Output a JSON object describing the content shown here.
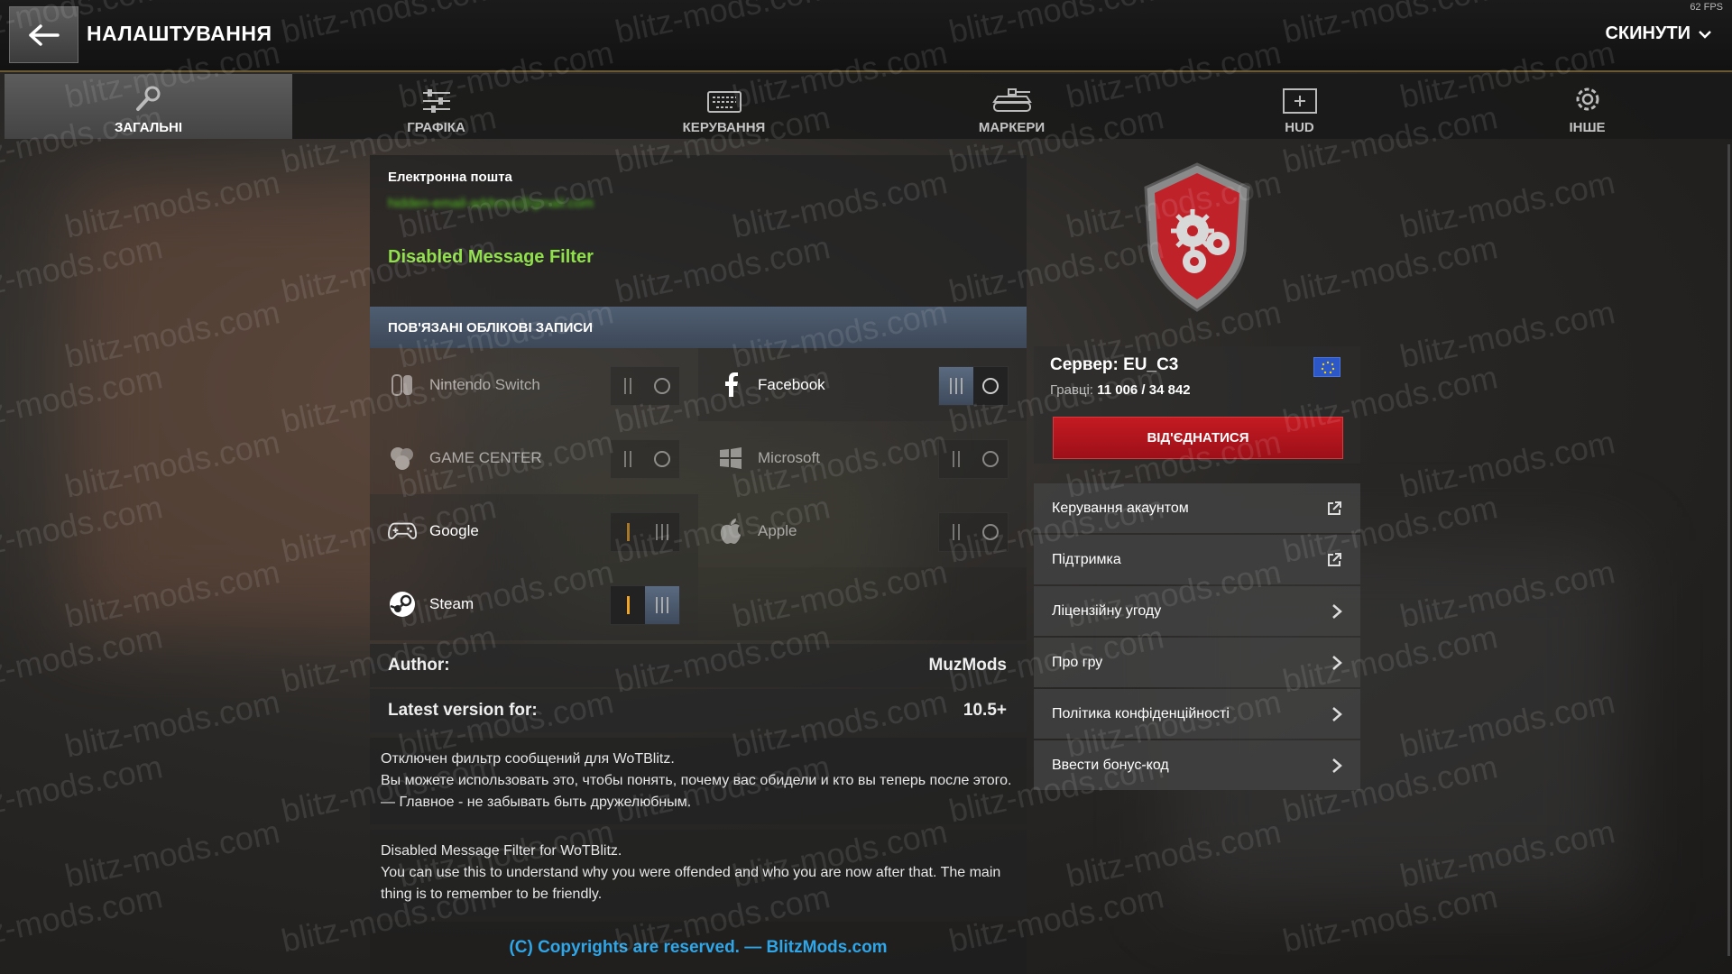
{
  "header": {
    "title": "НАЛАШТУВАННЯ",
    "reset_label": "СКИНУТИ",
    "fps": "62 FPS"
  },
  "tabs": [
    {
      "label": "ЗАГАЛЬНІ",
      "icon": "wrench-icon",
      "active": true
    },
    {
      "label": "ГРАФІКА",
      "icon": "sliders-icon",
      "active": false
    },
    {
      "label": "КЕРУВАННЯ",
      "icon": "keyboard-icon",
      "active": false
    },
    {
      "label": "МАРКЕРИ",
      "icon": "tank-icon",
      "active": false
    },
    {
      "label": "HUD",
      "icon": "hud-icon",
      "active": false
    },
    {
      "label": "ІНШЕ",
      "icon": "gear-icon",
      "active": false
    }
  ],
  "account": {
    "email_label": "Електронна пошта",
    "email_value": "hidden-email-address@gmail.com",
    "filter_name": "Disabled Message Filter",
    "linked_header": "ПОВ'ЯЗАНІ ОБЛІКОВІ ЗАПИСИ",
    "linked": [
      {
        "name": "Nintendo Switch",
        "icon": "nintendo-switch-icon",
        "state": "disabled"
      },
      {
        "name": "Facebook",
        "icon": "facebook-icon",
        "state": "off"
      },
      {
        "name": "GAME CENTER",
        "icon": "game-center-icon",
        "state": "disabled"
      },
      {
        "name": "Microsoft",
        "icon": "windows-icon",
        "state": "disabled"
      },
      {
        "name": "Google",
        "icon": "gamepad-icon",
        "state": "on-dim"
      },
      {
        "name": "Apple",
        "icon": "apple-icon",
        "state": "disabled"
      },
      {
        "name": "Steam",
        "icon": "steam-icon",
        "state": "on"
      }
    ]
  },
  "mod_info": {
    "author_label": "Author:",
    "author_value": "MuzMods",
    "version_label": "Latest version for:",
    "version_value": "10.5+",
    "desc_ru_1": "Отключен фильтр сообщений для WoTBlitz.",
    "desc_ru_2": "Вы можете использовать это, чтобы понять, почему вас обидели и кто вы теперь после этого. — Главное - не забывать быть дружелюбным.",
    "desc_en_1": "Disabled Message Filter for WoTBlitz.",
    "desc_en_2": "You can use this to understand why you were offended and who you are now after that. The main thing is to remember to be friendly.",
    "copyright": "(C) Copyrights are reserved. — BlitzMods.com"
  },
  "server": {
    "name": "Сервер: EU_C3",
    "players_label": "Гравці:",
    "players_value": "11 006 / 34 842",
    "disconnect_label": "ВІД'ЄДНАТИСЯ"
  },
  "menu": [
    {
      "label": "Керування акаунтом",
      "icon": "external-link-icon"
    },
    {
      "label": "Підтримка",
      "icon": "external-link-icon"
    },
    {
      "label": "Ліцензійну угоду",
      "icon": "chevron-right-icon"
    },
    {
      "label": "Про гру",
      "icon": "chevron-right-icon"
    },
    {
      "label": "Політика конфіденційності",
      "icon": "chevron-right-icon"
    },
    {
      "label": "Ввести бонус-код",
      "icon": "chevron-right-icon"
    }
  ],
  "watermark": "blitz-mods.com",
  "colors": {
    "accent_green": "#8fe04a",
    "disconnect_red": "#c41a22",
    "copyright_blue": "#2fa6e8",
    "toggle_on": "#f2a623"
  }
}
